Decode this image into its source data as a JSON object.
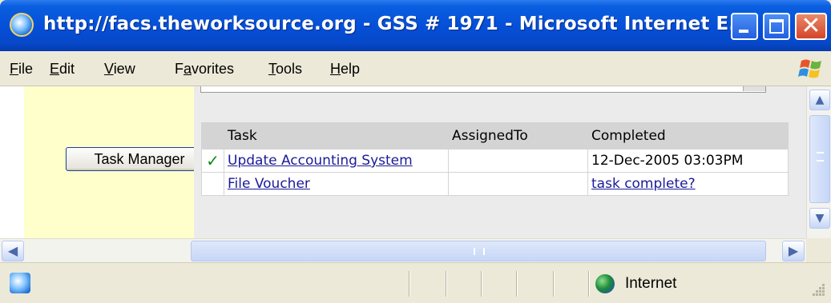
{
  "window": {
    "title": "http://facs.theworksource.org - GSS # 1971 - Microsoft Internet E...",
    "controls": {
      "minimize": "_",
      "maximize": "□",
      "close": "✕"
    }
  },
  "menu": {
    "items": [
      {
        "accel": "F",
        "rest": "ile"
      },
      {
        "accel": "E",
        "rest": "dit"
      },
      {
        "accel": "V",
        "rest": "iew"
      },
      {
        "pre": "F",
        "accel": "a",
        "rest": "vorites"
      },
      {
        "accel": "T",
        "rest": "ools"
      },
      {
        "accel": "H",
        "rest": "elp"
      }
    ]
  },
  "sidebar": {
    "task_manager_label": "Task Manager"
  },
  "table": {
    "headers": [
      "Task",
      "AssignedTo",
      "Completed"
    ],
    "rows": [
      {
        "checked": true,
        "check_glyph": "✓",
        "task": "Update Accounting System",
        "assigned_to": "",
        "completed": "12-Dec-2005 03:03PM",
        "completed_is_link": false
      },
      {
        "checked": false,
        "check_glyph": "",
        "task": "File Voucher",
        "assigned_to": "",
        "completed": "task complete?",
        "completed_is_link": true
      }
    ]
  },
  "scrollbars": {
    "up": "▲",
    "down": "▼",
    "left": "◀",
    "right": "▶"
  },
  "status": {
    "zone": "Internet"
  },
  "colors": {
    "titlebar": "#0550d8",
    "sidebar_bg": "#ffffcc",
    "table_header_bg": "#d4d4d4",
    "link": "#1a1a9a",
    "check": "#108a10"
  }
}
